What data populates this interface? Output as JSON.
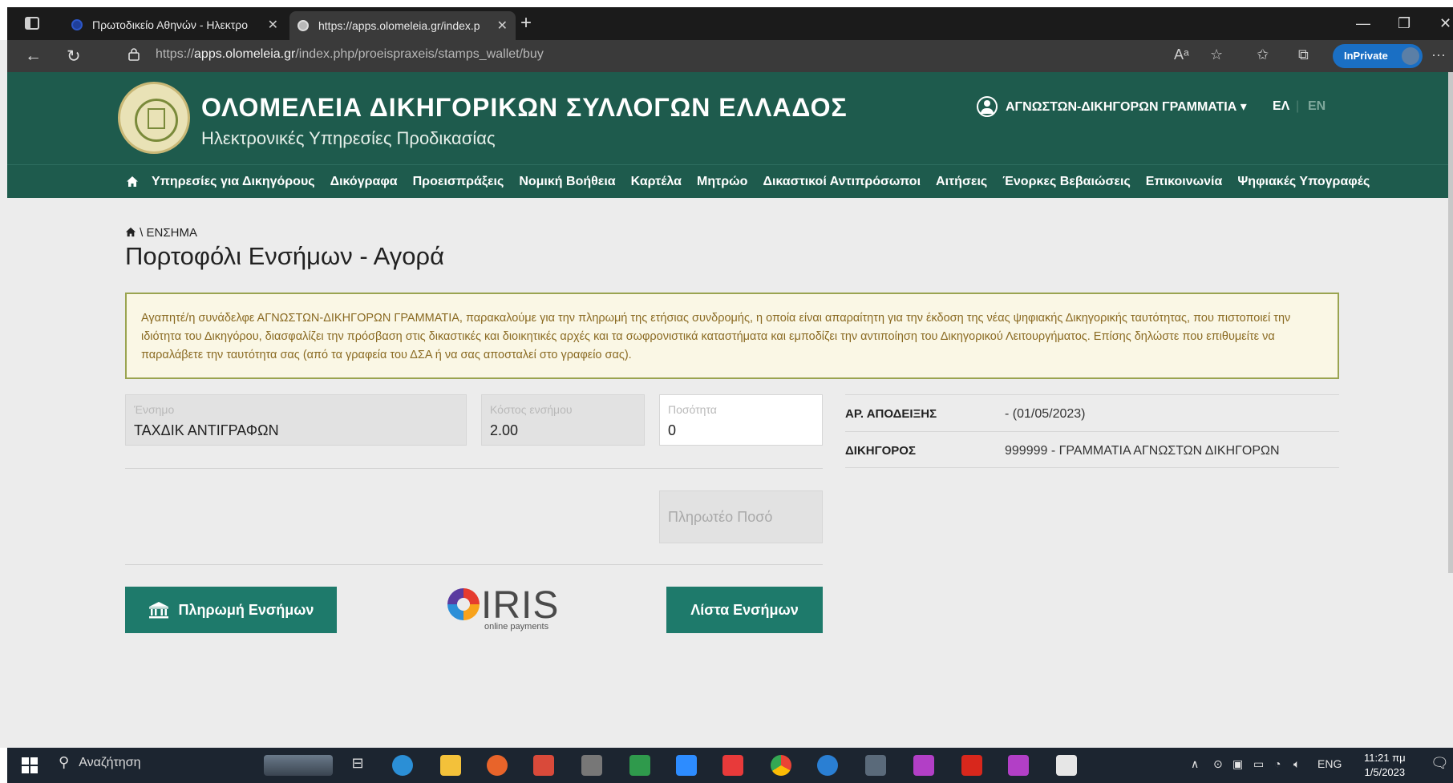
{
  "browser": {
    "tabs": [
      {
        "title": "Πρωτοδικείο Αθηνών - Ηλεκτρο"
      },
      {
        "title": "https://apps.olomeleia.gr/index.p"
      }
    ],
    "url_prefix": "https://",
    "url_domain": "apps.olomeleia.gr",
    "url_path": "/index.php/proeispraxeis/stamps_wallet/buy",
    "inprivate_label": "InPrivate"
  },
  "header": {
    "title": "ΟΛΟΜΕΛΕΙΑ ΔΙΚΗΓΟΡΙΚΩΝ ΣΥΛΛΟΓΩΝ ΕΛΛΑΔΟΣ",
    "subtitle": "Ηλεκτρονικές Υπηρεσίες Προδικασίας",
    "user": "ΑΓΝΩΣΤΩΝ-ΔΙΚΗΓΟΡΩΝ ΓΡΑΜΜΑΤΙΑ ▾",
    "lang_el": "ΕΛ",
    "lang_en": "EN"
  },
  "nav": {
    "items": [
      "Υπηρεσίες για Δικηγόρους",
      "Δικόγραφα",
      "Προεισπράξεις",
      "Νομική Βοήθεια",
      "Καρτέλα",
      "Μητρώο",
      "Δικαστικοί Αντιπρόσωποι",
      "Αιτήσεις",
      "Ένορκες Βεβαιώσεις",
      "Επικοινωνία",
      "Ψηφιακές Υπογραφές"
    ]
  },
  "page": {
    "breadcrumb": "\\ ΕΝΣΗΜΑ",
    "title": "Πορτοφόλι Ενσήμων - Αγορά",
    "notice": "Αγαπητέ/η συνάδελφε ΑΓΝΩΣΤΩΝ-ΔΙΚΗΓΟΡΩΝ ΓΡΑΜΜΑΤΙΑ, παρακαλούμε για την πληρωμή της ετήσιας συνδρομής, η οποία είναι απαραίτητη για την έκδοση της νέας ψηφιακής Δικηγορικής ταυτότητας, που πιστοποιεί την ιδιότητα του Δικηγόρου, διασφαλίζει την πρόσβαση στις δικαστικές και διοικητικές αρχές και τα σωφρονιστικά καταστήματα και εμποδίζει την αντιποίηση του Δικηγορικού Λειτουργήματος. Επίσης δηλώστε που επιθυμείτε να παραλάβετε την ταυτότητα σας (από τα γραφεία του ΔΣΑ ή να σας αποσταλεί στο γραφείο σας)."
  },
  "form": {
    "stamp_label": "Ένσημο",
    "stamp_value": "ΤΑΧΔΙΚ ΑΝΤΙΓΡΑΦΩΝ",
    "cost_label": "Κόστος ενσήμου",
    "cost_value": "2.00",
    "qty_label": "Ποσότητα",
    "qty_value": "0",
    "payable_placeholder": "Πληρωτέο Ποσό"
  },
  "info": {
    "receipt_key": "ΑΡ. ΑΠΟΔΕΙΞΗΣ",
    "receipt_value": "- (01/05/2023)",
    "lawyer_key": "ΔΙΚΗΓΟΡΟΣ",
    "lawyer_value": "999999 - ΓΡΑΜΜΑΤΙΑ ΑΓΝΩΣΤΩΝ ΔΙΚΗΓΟΡΩΝ"
  },
  "buttons": {
    "pay": "Πληρωμή Ενσήμων",
    "list": "Λίστα Ενσήμων"
  },
  "iris": {
    "word": "IRIS",
    "tag": "online payments"
  },
  "taskbar": {
    "search": "Αναζήτηση",
    "lang": "ENG",
    "time": "11:21 πμ",
    "date": "1/5/2023"
  },
  "colors": {
    "brand_green": "#1e5b4d",
    "button_teal": "#1e7a6b",
    "notice_bg": "#faf7e5",
    "notice_border": "#9aa450"
  }
}
